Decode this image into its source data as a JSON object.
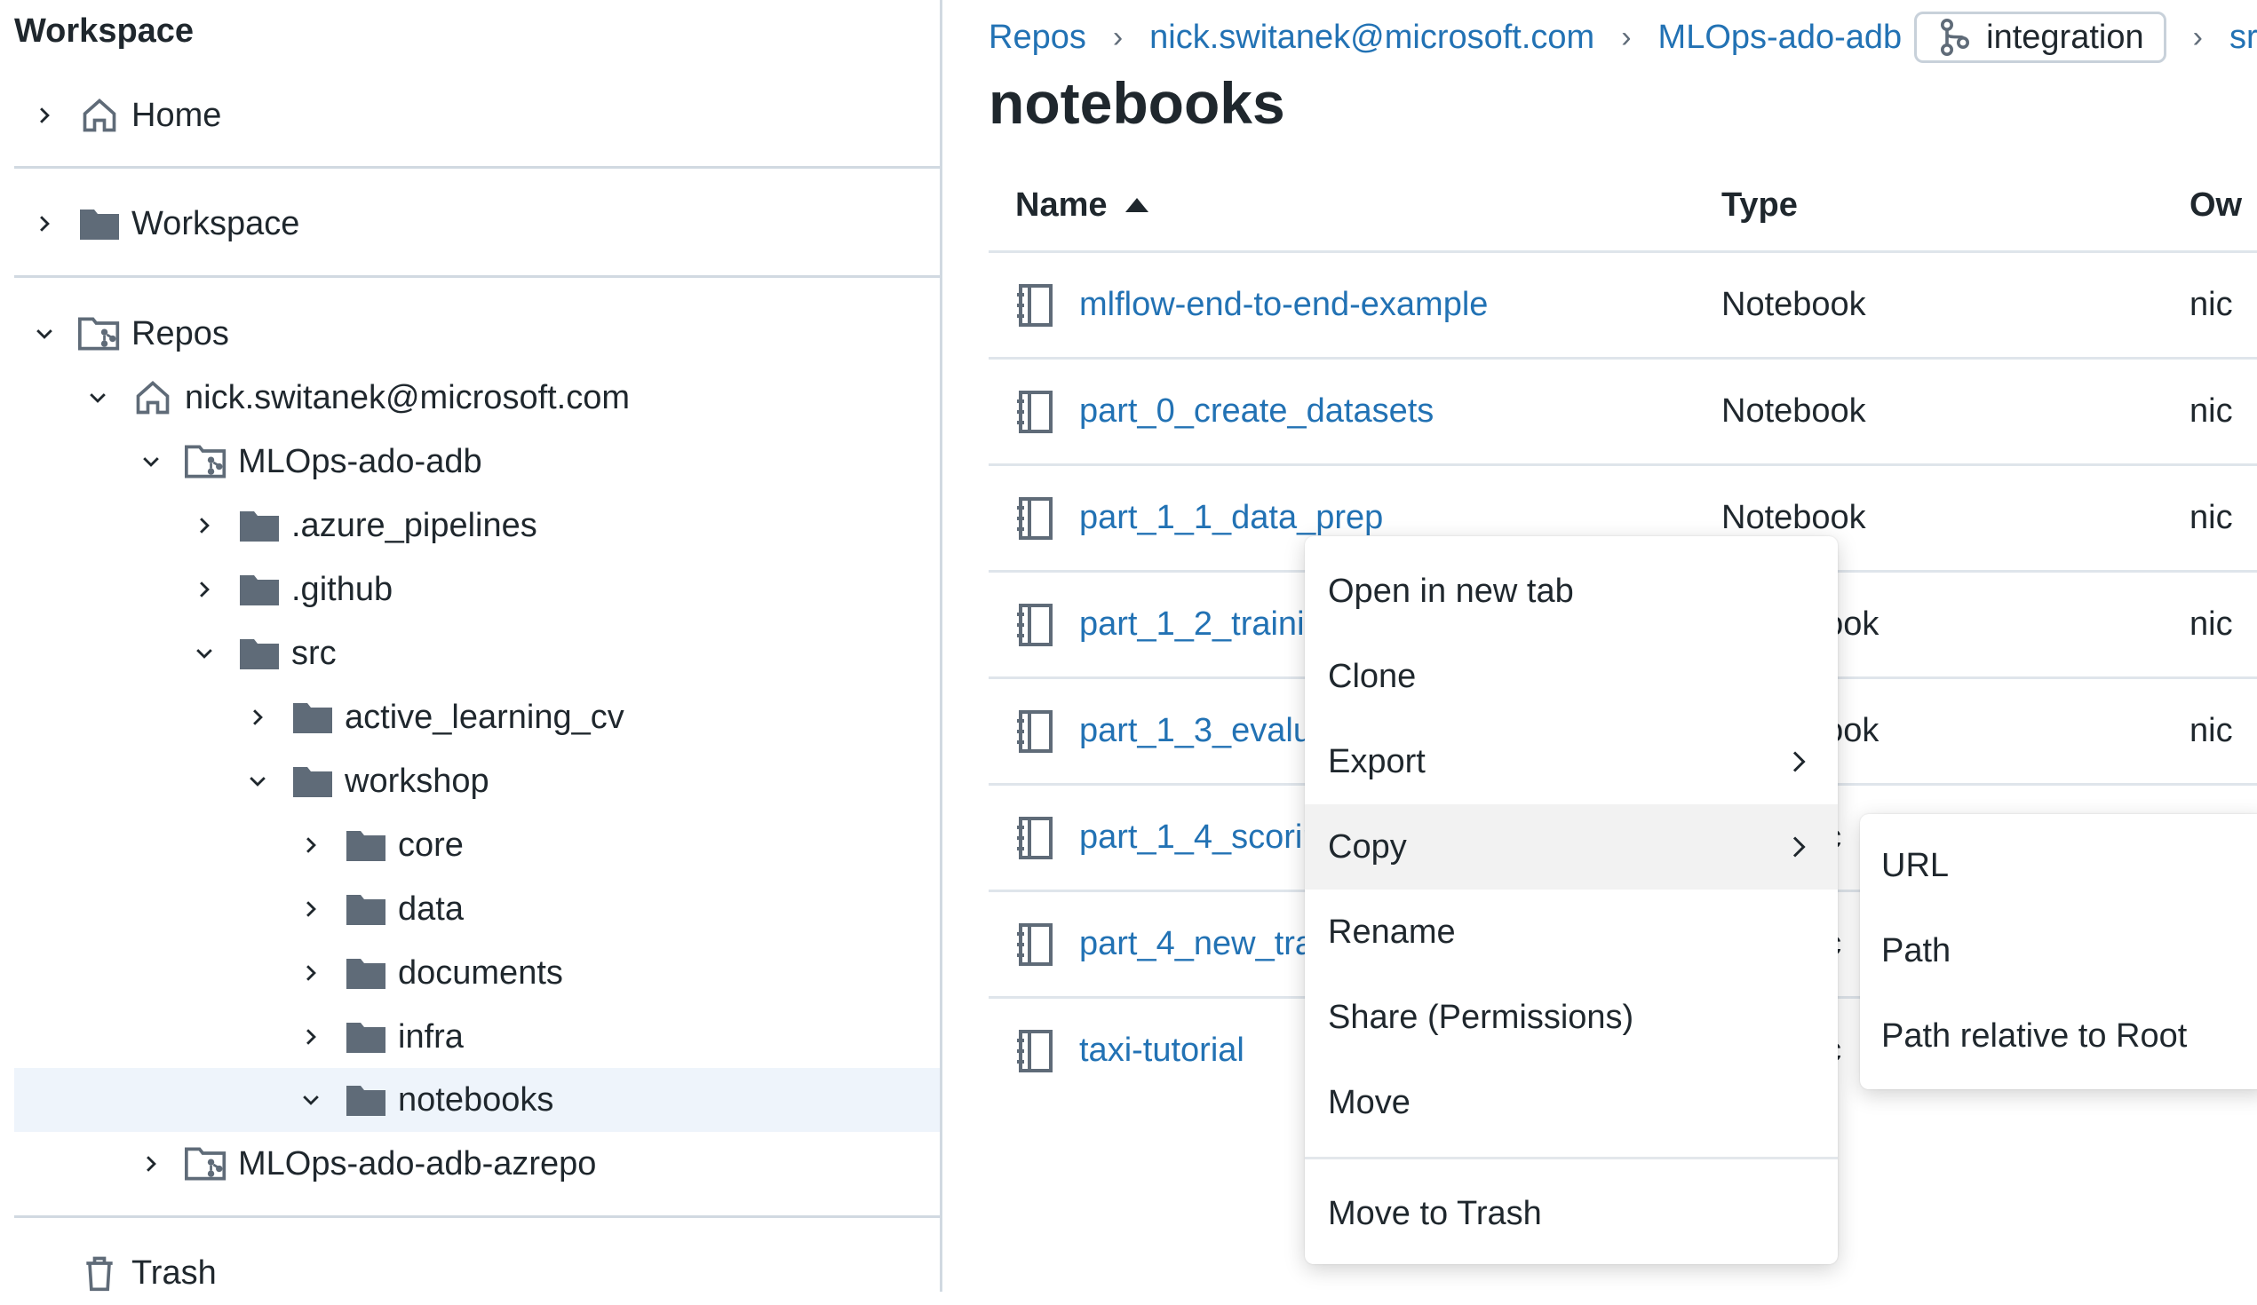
{
  "sidebar": {
    "title": "Workspace",
    "items": [
      {
        "label": "Home"
      },
      {
        "label": "Workspace"
      },
      {
        "label": "Repos"
      },
      {
        "label": "nick.switanek@microsoft.com"
      },
      {
        "label": "MLOps-ado-adb"
      },
      {
        "label": ".azure_pipelines"
      },
      {
        "label": ".github"
      },
      {
        "label": "src"
      },
      {
        "label": "active_learning_cv"
      },
      {
        "label": "workshop"
      },
      {
        "label": "core"
      },
      {
        "label": "data"
      },
      {
        "label": "documents"
      },
      {
        "label": "infra"
      },
      {
        "label": "notebooks"
      },
      {
        "label": "MLOps-ado-adb-azrepo"
      },
      {
        "label": "Trash"
      }
    ]
  },
  "breadcrumb": {
    "items": [
      "Repos",
      "nick.switanek@microsoft.com",
      "MLOps-ado-adb"
    ],
    "branch": "integration",
    "trailing": "sr"
  },
  "page_title": "notebooks",
  "table": {
    "headers": {
      "name": "Name",
      "type": "Type",
      "owner": "Ow"
    },
    "rows": [
      {
        "name": "mlflow-end-to-end-example",
        "type": "Notebook",
        "owner": "nic"
      },
      {
        "name": "part_0_create_datasets",
        "type": "Notebook",
        "owner": "nic"
      },
      {
        "name": "part_1_1_data_prep",
        "type": "Notebook",
        "owner": "nic"
      },
      {
        "name": "part_1_2_trainir",
        "type": "book",
        "owner": "nic"
      },
      {
        "name": "part_1_3_evalu",
        "type": "book",
        "owner": "nic"
      },
      {
        "name": "part_1_4_scorir",
        "type": "oc",
        "owner": ""
      },
      {
        "name": "part_4_new_tra",
        "type": "oc",
        "owner": ""
      },
      {
        "name": "taxi-tutorial",
        "type": "oc",
        "owner": ""
      }
    ]
  },
  "context_menu": {
    "items": [
      "Open in new tab",
      "Clone",
      "Export",
      "Copy",
      "Rename",
      "Share (Permissions)",
      "Move",
      "Move to Trash"
    ]
  },
  "submenu": {
    "items": [
      "URL",
      "Path",
      "Path relative to Root"
    ]
  },
  "icons": {
    "chevron_right": "chevron-right-icon",
    "chevron_down": "chevron-down-icon",
    "home": "home-icon",
    "folder": "folder-icon",
    "repo": "repo-icon",
    "trash": "trash-icon",
    "notebook": "notebook-icon",
    "branch": "branch-icon"
  },
  "colors": {
    "link": "#2272b4",
    "icon": "#5f6b78",
    "selected_row": "#eef4fb",
    "menu_active": "#f2f2f2"
  }
}
